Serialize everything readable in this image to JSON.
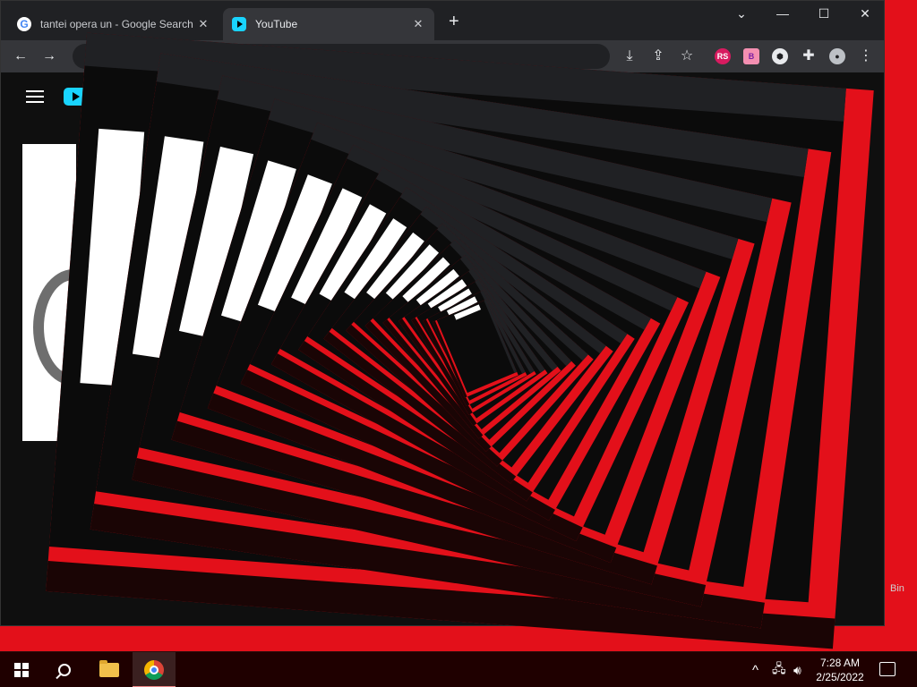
{
  "browser": {
    "tabs": [
      {
        "title": "tantei opera un - Google Search",
        "icon": "google-icon",
        "active": false
      },
      {
        "title": "YouTube",
        "icon": "youtube-icon",
        "active": true
      }
    ],
    "new_tab_label": "+",
    "window_controls": {
      "dropdown": "⌄",
      "minimize": "—",
      "maximize": "☐",
      "close": "✕"
    },
    "nav": {
      "back": "←",
      "forward": "→",
      "reload": "⟳"
    },
    "extensions": [
      {
        "label": "RS",
        "color": "#d81b60",
        "text_color": "#ffffff"
      },
      {
        "label": "B",
        "color": "#f48fb1",
        "text_color": "#7b1fa2"
      },
      {
        "label": "",
        "color": "#e8eaed",
        "text_color": "#202124"
      }
    ]
  },
  "colors": {
    "red": "#e3101a",
    "taskbar": "#1f0000",
    "yt_accent": "#19d4ff"
  },
  "taskbar": {
    "apps": [
      "start-icon",
      "search-icon",
      "file-explorer-icon",
      "chrome-icon"
    ],
    "tray_chevron": "^",
    "time": "7:28 AM",
    "date": "2/25/2022"
  },
  "desktop": {
    "recycle_bin_label": "Bin"
  }
}
